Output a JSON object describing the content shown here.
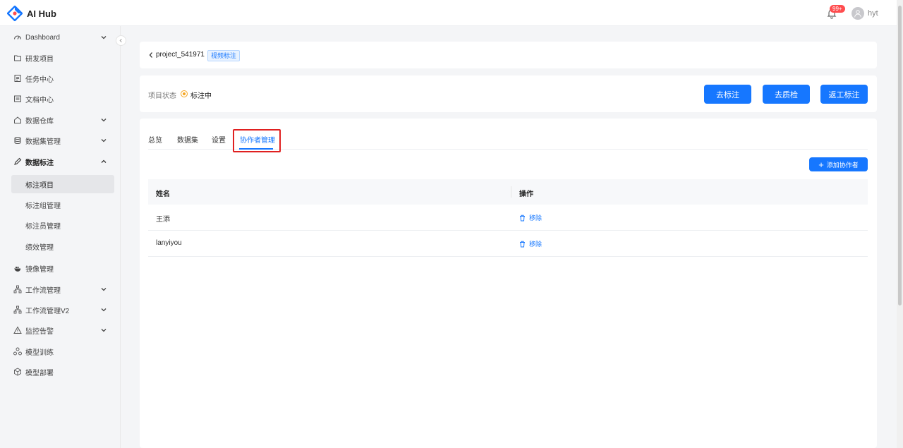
{
  "app": {
    "title": "AI Hub"
  },
  "header": {
    "notification_count": "99+",
    "username": "hyt"
  },
  "sidebar": {
    "items": [
      {
        "label": "Dashboard",
        "icon": "dashboard-icon",
        "expandable": true
      },
      {
        "label": "研发项目",
        "icon": "folder-icon"
      },
      {
        "label": "任务中心",
        "icon": "task-icon"
      },
      {
        "label": "文档中心",
        "icon": "document-icon"
      },
      {
        "label": "数据仓库",
        "icon": "home-icon",
        "expandable": true
      },
      {
        "label": "数据集管理",
        "icon": "database-icon",
        "expandable": true
      },
      {
        "label": "数据标注",
        "icon": "pen-icon",
        "expanded": true
      },
      {
        "label": "镜像管理",
        "icon": "whale-icon"
      },
      {
        "label": "工作流管理",
        "icon": "workflow-icon",
        "expandable": true
      },
      {
        "label": "工作流管理V2",
        "icon": "workflow-icon",
        "expandable": true
      },
      {
        "label": "监控告警",
        "icon": "warning-icon",
        "expandable": true
      },
      {
        "label": "模型训练",
        "icon": "train-icon"
      },
      {
        "label": "模型部署",
        "icon": "cube-icon"
      }
    ],
    "sub_items": [
      {
        "label": "标注项目",
        "active": true
      },
      {
        "label": "标注组管理"
      },
      {
        "label": "标注员管理"
      },
      {
        "label": "绩效管理"
      }
    ]
  },
  "breadcrumb": {
    "project": "project_541971",
    "tag": "视频标注"
  },
  "status": {
    "label": "项目状态",
    "value": "标注中",
    "color": "#f5a623"
  },
  "actions": {
    "annotate": "去标注",
    "qa": "去质检",
    "rework": "返工标注"
  },
  "tabs": [
    {
      "label": "总览"
    },
    {
      "label": "数据集"
    },
    {
      "label": "设置"
    },
    {
      "label": "协作者管理",
      "active": true
    }
  ],
  "add_collaborator": "添加协作者",
  "table": {
    "columns": [
      "姓名",
      "操作"
    ],
    "rows": [
      {
        "name": "王添",
        "action": "移除"
      },
      {
        "name": "lanyiyou",
        "action": "移除"
      }
    ]
  },
  "colors": {
    "accent": "#1677ff",
    "highlight": "#e02020"
  }
}
